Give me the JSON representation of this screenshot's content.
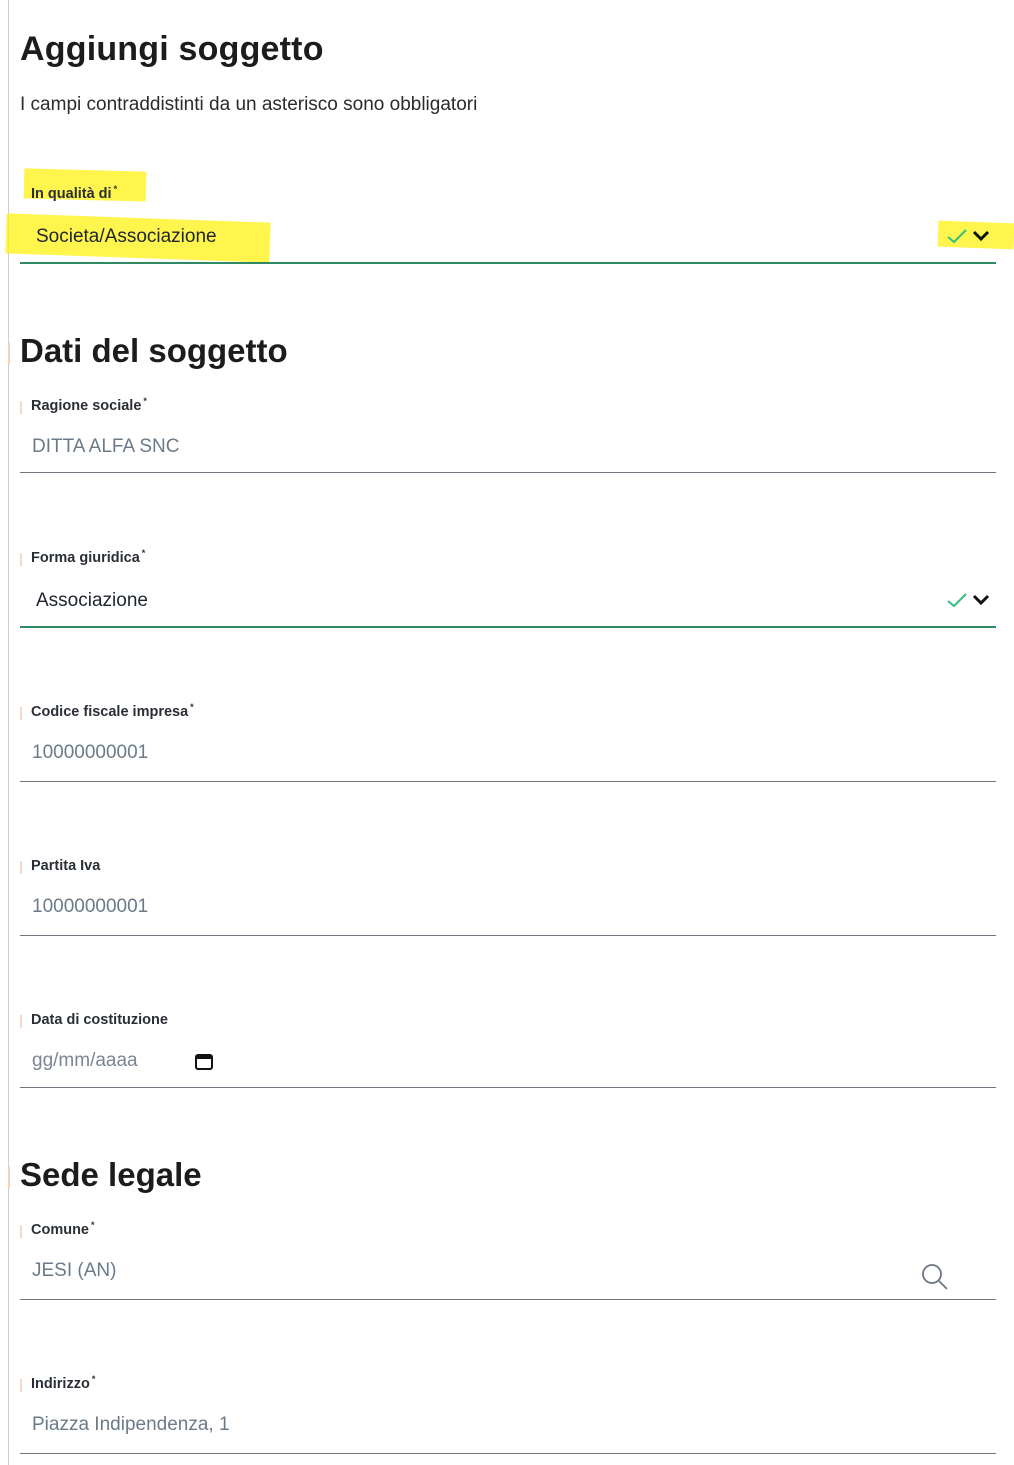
{
  "page": {
    "title": "Aggiungi soggetto",
    "subtitle": "I campi contraddistinti da un asterisco sono obbligatori"
  },
  "role": {
    "label": "In qualità di",
    "required_mark": "*",
    "value": "Societa/Associazione",
    "valid": true
  },
  "sections": {
    "subject_data": "Dati del soggetto",
    "registered_office": "Sede legale"
  },
  "fields": {
    "ragione_sociale": {
      "label": "Ragione sociale",
      "required_mark": "*",
      "value": "DITTA ALFA SNC"
    },
    "forma_giuridica": {
      "label": "Forma giuridica",
      "required_mark": "*",
      "value": "Associazione",
      "valid": true
    },
    "codice_fiscale": {
      "label": "Codice fiscale impresa",
      "required_mark": "*",
      "value": "10000000001"
    },
    "partita_iva": {
      "label": "Partita Iva",
      "value": "10000000001"
    },
    "data_costituzione": {
      "label": "Data di costituzione",
      "placeholder": "gg/mm/aaaa"
    },
    "comune": {
      "label": "Comune",
      "required_mark": "*",
      "value": "JESI (AN)"
    },
    "indirizzo": {
      "label": "Indirizzo",
      "required_mark": "*",
      "value": "Piazza Indipendenza, 1"
    }
  },
  "icons": {
    "valid_check": "check-icon",
    "dropdown": "chevron-down-icon",
    "date_picker": "calendar-icon",
    "lookup": "search-icon"
  },
  "colors": {
    "valid_green": "#2f8a63",
    "check_green": "#33c07b",
    "annotation_highlight": "#fff21a"
  }
}
